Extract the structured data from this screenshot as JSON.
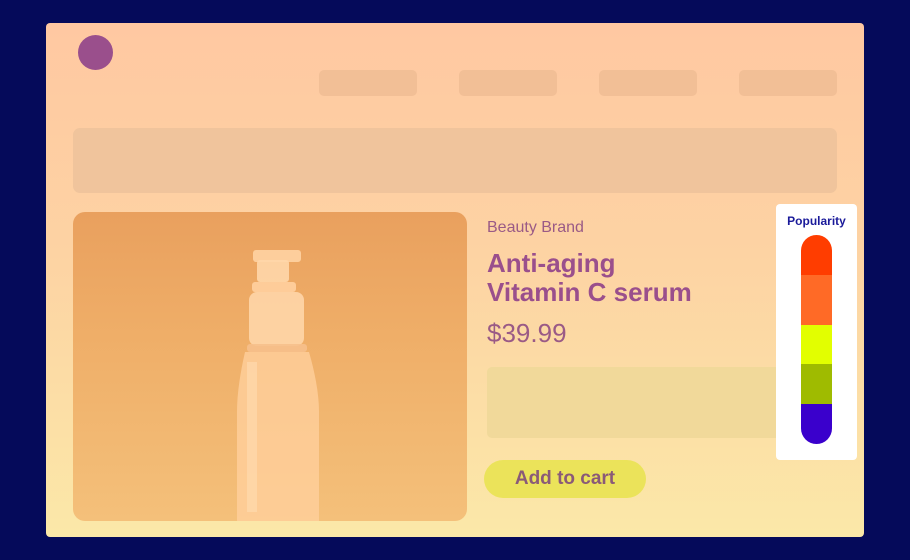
{
  "product": {
    "brand": "Beauty Brand",
    "title": "Anti-aging\nVitamin C serum",
    "price": "$39.99",
    "add_to_cart_label": "Add to cart"
  },
  "popularity": {
    "title": "Popularity",
    "colors": [
      "#ff3d00",
      "#ff6a26",
      "#e2ff00",
      "#9fbb00",
      "#3a00cc"
    ]
  },
  "theme": {
    "background": "#050a5a",
    "accent": "#9a4f8c",
    "button": "#ebe35a"
  }
}
